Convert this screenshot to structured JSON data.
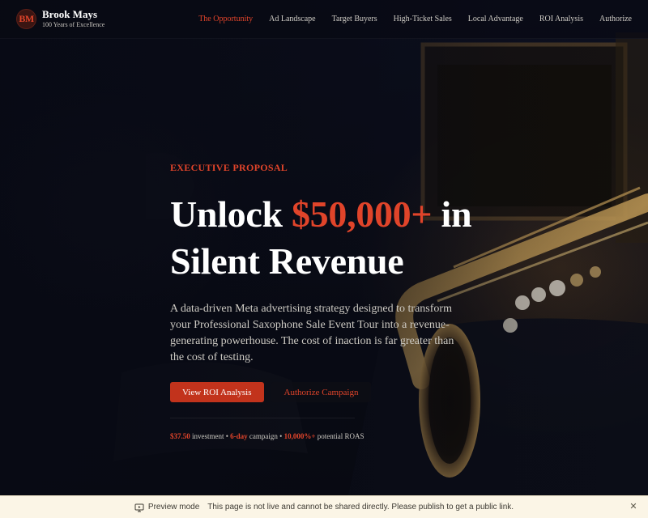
{
  "brand": {
    "initials": "BM",
    "name": "Brook Mays",
    "tagline": "100 Years of Excellence"
  },
  "nav": {
    "items": [
      {
        "label": "The Opportunity",
        "active": true
      },
      {
        "label": "Ad Landscape",
        "active": false
      },
      {
        "label": "Target Buyers",
        "active": false
      },
      {
        "label": "High-Ticket Sales",
        "active": false
      },
      {
        "label": "Local Advantage",
        "active": false
      },
      {
        "label": "ROI Analysis",
        "active": false
      },
      {
        "label": "Authorize",
        "active": false
      }
    ]
  },
  "hero": {
    "eyebrow": "EXECUTIVE PROPOSAL",
    "headline_pre": "Unlock ",
    "headline_accent": "$50,000+",
    "headline_post": " in Silent Revenue",
    "description": "A data-driven Meta advertising strategy designed to transform your Professional Saxophone Sale Event Tour into a revenue-generating powerhouse. The cost of inaction is far greater than the cost of testing.",
    "primary_button": "View ROI Analysis",
    "secondary_button": "Authorize Campaign",
    "stats": {
      "investment_value": "$37.50",
      "investment_label": " investment • ",
      "campaign_value": "6-day",
      "campaign_label": " campaign • ",
      "roas_value": "10,000%+",
      "roas_label": " potential ROAS"
    }
  },
  "preview_bar": {
    "icon": "preview-icon",
    "label": "Preview mode",
    "message": "This page is not live and cannot be shared directly. Please publish to get a public link.",
    "close_icon": "close-icon"
  },
  "colors": {
    "accent": "#e0442a",
    "button": "#c2331c",
    "background": "#0b0d17",
    "preview_bar": "#fbf5e6"
  }
}
